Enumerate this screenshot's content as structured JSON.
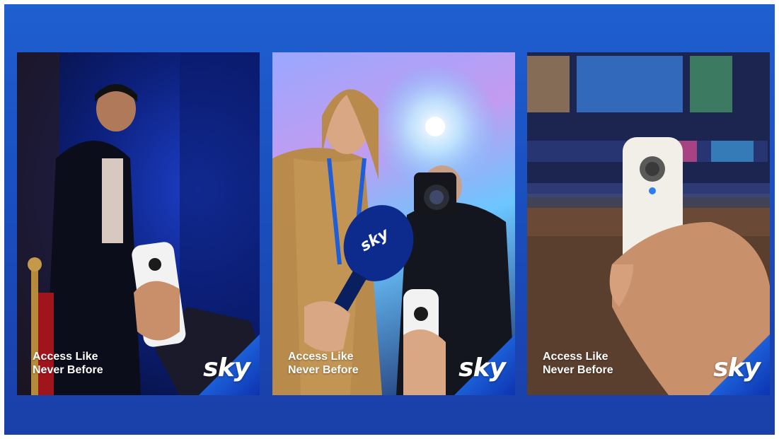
{
  "colors": {
    "background_blue": "#1a4fbf",
    "brand_white": "#ffffff",
    "corner_gradient_start": "#2a8bff",
    "corner_gradient_end": "#0d33b0"
  },
  "posters": [
    {
      "tagline_line1": "Access Like",
      "tagline_line2": "Never Before",
      "logo_text": "sky",
      "scene": "man in beanie receiving a remote control on a blue-lit stage"
    },
    {
      "tagline_line1": "Access Like",
      "tagline_line2": "Never Before",
      "logo_text": "sky",
      "scene": "woman reporter with sky microphone and photographer with camera flash"
    },
    {
      "tagline_line1": "Access Like",
      "tagline_line2": "Never Before",
      "logo_text": "sky",
      "scene": "hand holding a white remote control in front of a blurred TV screen"
    }
  ]
}
